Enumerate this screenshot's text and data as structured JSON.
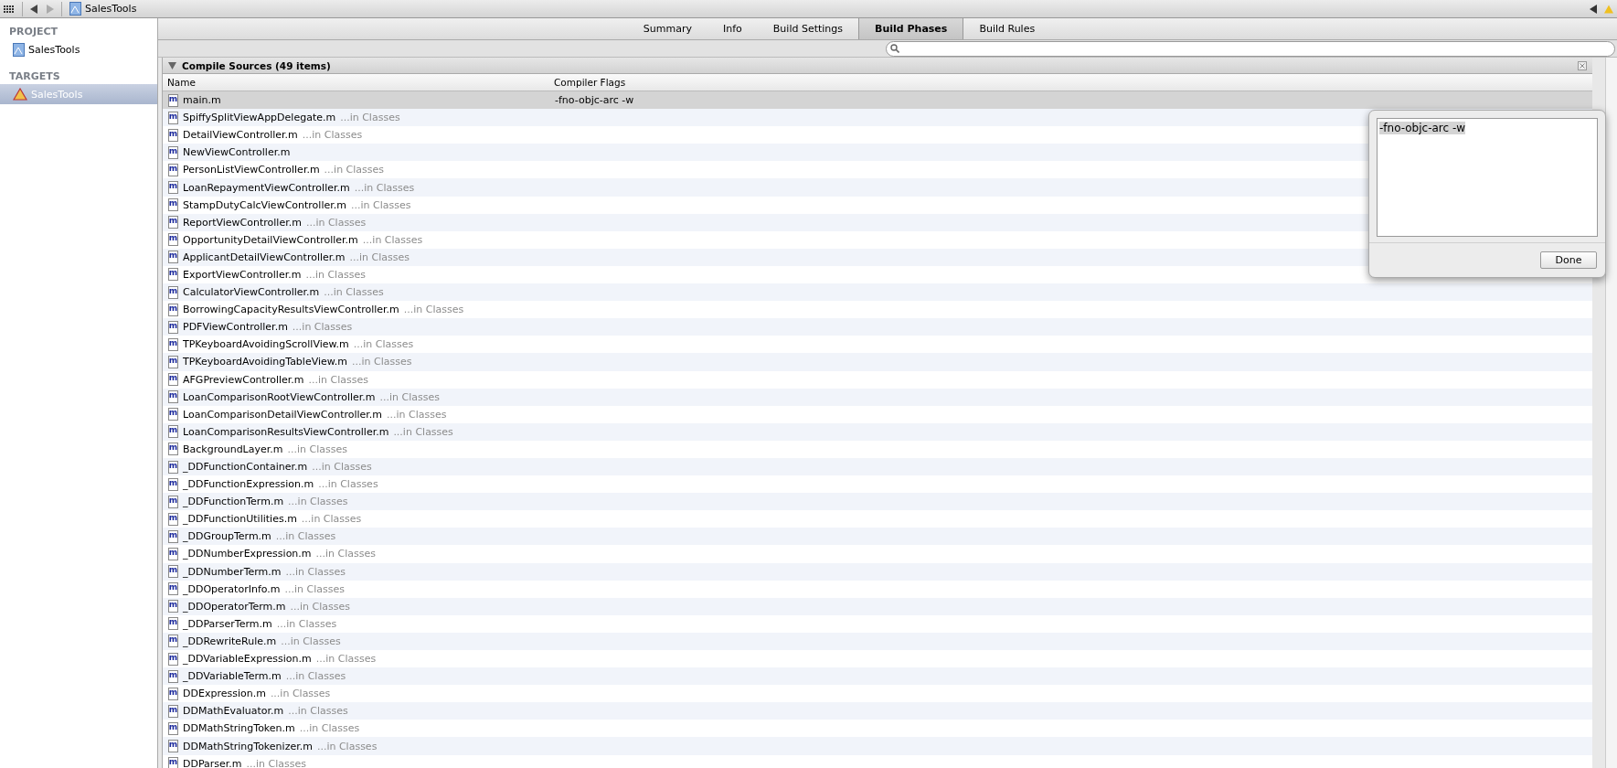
{
  "toolbar": {
    "breadcrumb": "SalesTools"
  },
  "sidebar": {
    "sections": [
      {
        "heading": "PROJECT",
        "items": [
          {
            "label": "SalesTools",
            "kind": "project",
            "selected": false
          }
        ]
      },
      {
        "heading": "TARGETS",
        "items": [
          {
            "label": "SalesTools",
            "kind": "target",
            "selected": true
          }
        ]
      }
    ]
  },
  "tabs": [
    {
      "label": "Summary",
      "selected": false
    },
    {
      "label": "Info",
      "selected": false
    },
    {
      "label": "Build Settings",
      "selected": false
    },
    {
      "label": "Build Phases",
      "selected": true
    },
    {
      "label": "Build Rules",
      "selected": false
    }
  ],
  "phase": {
    "title": "Compile Sources (49 items)",
    "expanded": true,
    "columns": [
      "Name",
      "Compiler Flags"
    ],
    "rows": [
      {
        "icon": "m",
        "file": "main.m",
        "location": "",
        "flags": "-fno-objc-arc -w",
        "selected": true
      },
      {
        "icon": "m",
        "file": "SpiffySplitViewAppDelegate.m",
        "location": "...in Classes",
        "flags": "",
        "selected": false
      },
      {
        "icon": "m",
        "file": "DetailViewController.m",
        "location": "...in Classes",
        "flags": "",
        "selected": false
      },
      {
        "icon": "m",
        "file": "NewViewController.m",
        "location": "",
        "flags": "",
        "selected": false
      },
      {
        "icon": "m",
        "file": "PersonListViewController.m",
        "location": "...in Classes",
        "flags": "",
        "selected": false
      },
      {
        "icon": "m",
        "file": "LoanRepaymentViewController.m",
        "location": "...in Classes",
        "flags": "",
        "selected": false
      },
      {
        "icon": "m",
        "file": "StampDutyCalcViewController.m",
        "location": "...in Classes",
        "flags": "",
        "selected": false
      },
      {
        "icon": "m",
        "file": "ReportViewController.m",
        "location": "...in Classes",
        "flags": "",
        "selected": false
      },
      {
        "icon": "m",
        "file": "OpportunityDetailViewController.m",
        "location": "...in Classes",
        "flags": "",
        "selected": false
      },
      {
        "icon": "m",
        "file": "ApplicantDetailViewController.m",
        "location": "...in Classes",
        "flags": "",
        "selected": false
      },
      {
        "icon": "m",
        "file": "ExportViewController.m",
        "location": "...in Classes",
        "flags": "",
        "selected": false
      },
      {
        "icon": "m",
        "file": "CalculatorViewController.m",
        "location": "...in Classes",
        "flags": "",
        "selected": false
      },
      {
        "icon": "m",
        "file": "BorrowingCapacityResultsViewController.m",
        "location": "...in Classes",
        "flags": "",
        "selected": false
      },
      {
        "icon": "m",
        "file": "PDFViewController.m",
        "location": "...in Classes",
        "flags": "",
        "selected": false
      },
      {
        "icon": "m",
        "file": "TPKeyboardAvoidingScrollView.m",
        "location": "...in Classes",
        "flags": "",
        "selected": false
      },
      {
        "icon": "m",
        "file": "TPKeyboardAvoidingTableView.m",
        "location": "...in Classes",
        "flags": "",
        "selected": false
      },
      {
        "icon": "m",
        "file": "AFGPreviewController.m",
        "location": "...in Classes",
        "flags": "",
        "selected": false
      },
      {
        "icon": "m",
        "file": "LoanComparisonRootViewController.m",
        "location": "...in Classes",
        "flags": "",
        "selected": false
      },
      {
        "icon": "m",
        "file": "LoanComparisonDetailViewController.m",
        "location": "...in Classes",
        "flags": "",
        "selected": false
      },
      {
        "icon": "m",
        "file": "LoanComparisonResultsViewController.m",
        "location": "...in Classes",
        "flags": "",
        "selected": false
      },
      {
        "icon": "m",
        "file": "BackgroundLayer.m",
        "location": "...in Classes",
        "flags": "",
        "selected": false
      },
      {
        "icon": "m",
        "file": "_DDFunctionContainer.m",
        "location": "...in Classes",
        "flags": "",
        "selected": false
      },
      {
        "icon": "m",
        "file": "_DDFunctionExpression.m",
        "location": "...in Classes",
        "flags": "",
        "selected": false
      },
      {
        "icon": "m",
        "file": "_DDFunctionTerm.m",
        "location": "...in Classes",
        "flags": "",
        "selected": false
      },
      {
        "icon": "m",
        "file": "_DDFunctionUtilities.m",
        "location": "...in Classes",
        "flags": "",
        "selected": false
      },
      {
        "icon": "m",
        "file": "_DDGroupTerm.m",
        "location": "...in Classes",
        "flags": "",
        "selected": false
      },
      {
        "icon": "m",
        "file": "_DDNumberExpression.m",
        "location": "...in Classes",
        "flags": "",
        "selected": false
      },
      {
        "icon": "m",
        "file": "_DDNumberTerm.m",
        "location": "...in Classes",
        "flags": "",
        "selected": false
      },
      {
        "icon": "m",
        "file": "_DDOperatorInfo.m",
        "location": "...in Classes",
        "flags": "",
        "selected": false
      },
      {
        "icon": "m",
        "file": "_DDOperatorTerm.m",
        "location": "...in Classes",
        "flags": "",
        "selected": false
      },
      {
        "icon": "m",
        "file": "_DDParserTerm.m",
        "location": "...in Classes",
        "flags": "",
        "selected": false
      },
      {
        "icon": "m",
        "file": "_DDRewriteRule.m",
        "location": "...in Classes",
        "flags": "",
        "selected": false
      },
      {
        "icon": "m",
        "file": "_DDVariableExpression.m",
        "location": "...in Classes",
        "flags": "",
        "selected": false
      },
      {
        "icon": "m",
        "file": "_DDVariableTerm.m",
        "location": "...in Classes",
        "flags": "",
        "selected": false
      },
      {
        "icon": "m",
        "file": "DDExpression.m",
        "location": "...in Classes",
        "flags": "",
        "selected": false
      },
      {
        "icon": "m",
        "file": "DDMathEvaluator.m",
        "location": "...in Classes",
        "flags": "",
        "selected": false
      },
      {
        "icon": "m",
        "file": "DDMathStringToken.m",
        "location": "...in Classes",
        "flags": "",
        "selected": false
      },
      {
        "icon": "m",
        "file": "DDMathStringTokenizer.m",
        "location": "...in Classes",
        "flags": "",
        "selected": false
      },
      {
        "icon": "m",
        "file": "DDParser.m",
        "location": "...in Classes",
        "flags": "",
        "selected": false
      }
    ]
  },
  "popover": {
    "value": "-fno-objc-arc -w",
    "button": "Done"
  }
}
